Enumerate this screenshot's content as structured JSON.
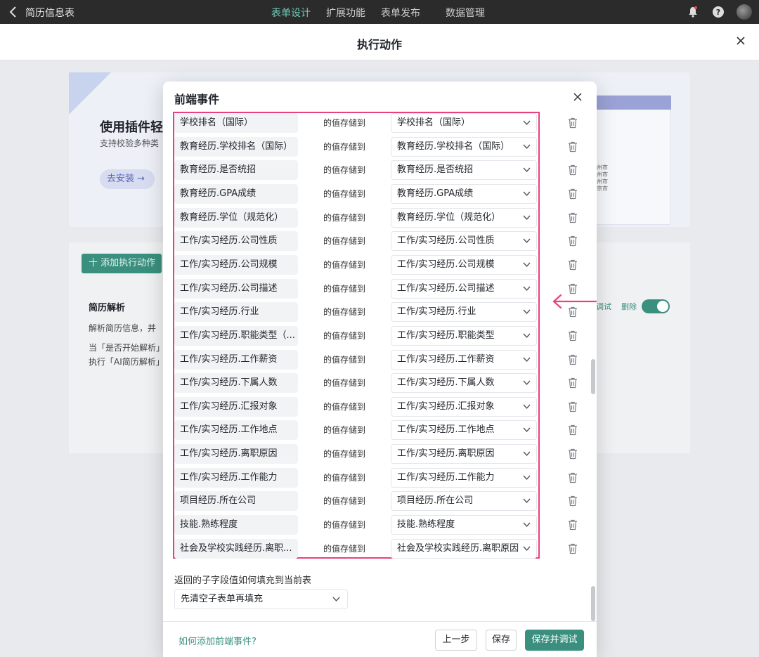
{
  "topbar": {
    "app_title": "简历信息表",
    "tabs": [
      "表单设计",
      "扩展功能",
      "表单发布",
      "数据管理"
    ],
    "active_tab": 0
  },
  "exec_modal": {
    "title": "执行动作"
  },
  "background": {
    "promo_title": "使用插件轻",
    "promo_sub": "支持校验多种类",
    "promo_btn": "去安装 →",
    "promo_img_text": "州市\n州市\n州市\n京市",
    "add_action": "十 添加执行动作",
    "resume_title": "简历解析",
    "resume_line1": "解析简历信息，并",
    "resume_line2": "当「是否开始解析」",
    "resume_line3": "执行「AI简历解析」",
    "debug_link": "调试",
    "delete_link": "删除"
  },
  "dialog": {
    "title": "前端事件",
    "stored_to": "的值存储到",
    "rows": [
      {
        "field": "学校排名（国际）",
        "target": "学校排名（国际）"
      },
      {
        "field": "教育经历.学校排名（国际）",
        "target": "教育经历.学校排名（国际）"
      },
      {
        "field": "教育经历.是否统招",
        "target": "教育经历.是否统招"
      },
      {
        "field": "教育经历.GPA成绩",
        "target": "教育经历.GPA成绩"
      },
      {
        "field": "教育经历.学位（规范化）",
        "target": "教育经历.学位（规范化）"
      },
      {
        "field": "工作/实习经历.公司性质",
        "target": "工作/实习经历.公司性质"
      },
      {
        "field": "工作/实习经历.公司规模",
        "target": "工作/实习经历.公司规模"
      },
      {
        "field": "工作/实习经历.公司描述",
        "target": "工作/实习经历.公司描述"
      },
      {
        "field": "工作/实习经历.行业",
        "target": "工作/实习经历.行业"
      },
      {
        "field": "工作/实习经历.职能类型（...",
        "target": "工作/实习经历.职能类型"
      },
      {
        "field": "工作/实习经历.工作薪资",
        "target": "工作/实习经历.工作薪资"
      },
      {
        "field": "工作/实习经历.下属人数",
        "target": "工作/实习经历.下属人数"
      },
      {
        "field": "工作/实习经历.汇报对象",
        "target": "工作/实习经历.汇报对象"
      },
      {
        "field": "工作/实习经历.工作地点",
        "target": "工作/实习经历.工作地点"
      },
      {
        "field": "工作/实习经历.离职原因",
        "target": "工作/实习经历.离职原因"
      },
      {
        "field": "工作/实习经历.工作能力",
        "target": "工作/实习经历.工作能力"
      },
      {
        "field": "项目经历.所在公司",
        "target": "项目经历.所在公司"
      },
      {
        "field": "技能.熟练程度",
        "target": "技能.熟练程度"
      },
      {
        "field": "社会及学校实践经历.离职...",
        "target": "社会及学校实践经历.离职原因"
      }
    ],
    "fill_label": "返回的子字段值如何填充到当前表",
    "fill_value": "先清空子表单再填充",
    "help_link": "如何添加前端事件?",
    "btn_prev": "上一步",
    "btn_save": "保存",
    "btn_save_debug": "保存并调试"
  },
  "colors": {
    "accent": "#3a8f7e",
    "highlight_border": "#e8417d",
    "topbar_bg": "#2b2b2b"
  },
  "icons": [
    "chevron-left-icon",
    "bell-icon",
    "help-icon",
    "avatar",
    "close-icon",
    "chevron-down-icon",
    "trash-icon",
    "arrow-left-icon"
  ]
}
